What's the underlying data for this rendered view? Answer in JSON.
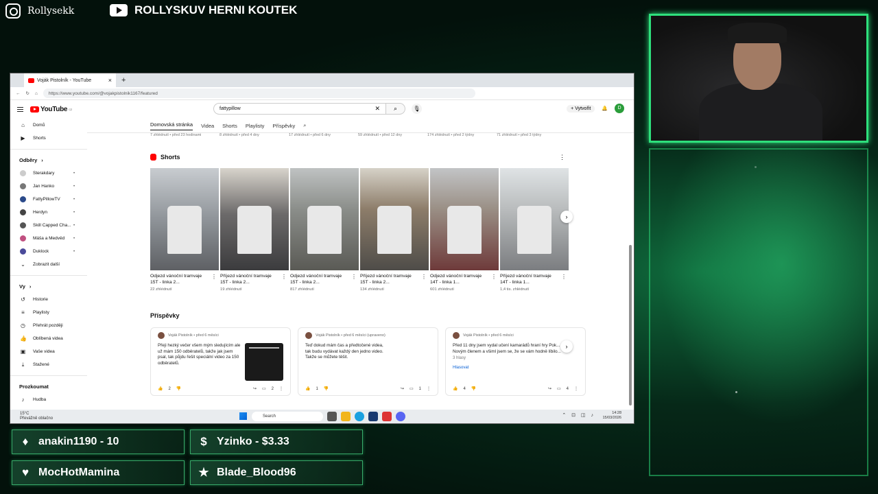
{
  "overlay": {
    "instagram": "Rollysekk",
    "stream_title": "ROLLYSKUV HERNI KOUTEK",
    "alerts": [
      {
        "icon": "diamond-icon",
        "text": "anakin1190 - 10"
      },
      {
        "icon": "dollar-icon",
        "text": "Yzinko - $3.33"
      },
      {
        "icon": "heart-icon",
        "text": "MocHotMamina"
      },
      {
        "icon": "star-icon",
        "text": "Blade_Blood96"
      }
    ]
  },
  "browser": {
    "tab_title": "Voják Pistolník - YouTube",
    "url": "https://www.youtube.com/@vojakpistolnik1167/featured",
    "youtube": {
      "logo": "YouTube",
      "logo_region": "CZ",
      "search_value": "fattypillow",
      "create_label": "Vytvořit",
      "avatar_letter": "D",
      "sidebar": {
        "main": [
          {
            "icon": "home-icon",
            "label": "Domů"
          },
          {
            "icon": "shorts-icon",
            "label": "Shorts"
          }
        ],
        "subs_header": "Odběry",
        "subs": [
          "Sterakdary",
          "Jan Hanko",
          "FattyPillowTV",
          "Herdyn",
          "Skill Capped Cha...",
          "Máša a Medvěd",
          "Duklock"
        ],
        "show_more": "Zobrazit další",
        "you_header": "Vy",
        "you": [
          {
            "icon": "history-icon",
            "label": "Historie"
          },
          {
            "icon": "playlist-icon",
            "label": "Playlisty"
          },
          {
            "icon": "clock-icon",
            "label": "Přehrát později"
          },
          {
            "icon": "like-icon",
            "label": "Oblíbená videa"
          },
          {
            "icon": "video-icon",
            "label": "Vaše videa"
          },
          {
            "icon": "download-icon",
            "label": "Stažené"
          }
        ],
        "explore_header": "Prozkoumat",
        "explore": [
          {
            "icon": "music-icon",
            "label": "Hudba"
          }
        ]
      },
      "channel_tabs": [
        "Domovská stránka",
        "Videa",
        "Shorts",
        "Playlisty",
        "Příspěvky"
      ],
      "prev_row": [
        "7 zhlédnutí • před 23 hodinami",
        "8 zhlédnutí • před 4 dny",
        "17 zhlédnutí • před 6 dny",
        "59 zhlédnutí • před 12 dny",
        "174 zhlédnutí • před 2 týdny",
        "71 zhlédnutí • před 3 týdny"
      ],
      "shorts_header": "Shorts",
      "shorts": [
        {
          "title": "Odjezd vánoční tramvaje 15T - linka 2...",
          "views": "22 zhlédnutí"
        },
        {
          "title": "Příjezd vánoční tramvaje 15T - linka 2...",
          "views": "19 zhlédnutí"
        },
        {
          "title": "Odjezd vánoční tramvaje 15T - linka 2...",
          "views": "817 zhlédnutí"
        },
        {
          "title": "Příjezd vánoční tramvaje 15T - linka 2...",
          "views": "134 zhlédnutí"
        },
        {
          "title": "Odjezd vánoční tramvaje 14T - linka 1...",
          "views": "601 zhlédnutí"
        },
        {
          "title": "Příjezd vánoční tramvaje 14T - linka 1...",
          "views": "1,4 tis. zhlédnutí"
        }
      ],
      "posts_header": "Příspěvky",
      "posts": [
        {
          "author": "Voják Pistolník • před 6 měsíci",
          "text": "Přeji hezký večer všem mým sledujícím ale už mám 150 odběratelů, takže jak jsem psal, tak půjdu řešit speciální video za 150 odběratelů.",
          "likes": "2",
          "comments": "2"
        },
        {
          "author": "Voják Pistolník • před 6 měsíci (upraveno)",
          "text": "Teď dokud mám čas a předtočené videa, tak budu vydávat každý den jedno video. Takže se můžete těšit.",
          "likes": "1",
          "comments": "1"
        },
        {
          "author": "Voják Pistolník • před 6 měsíci",
          "text": "Před 11 dny jsem vydal učení kamarádů hraní hry Pok... s Novým členem a všiml jsem se, že se vám hodně líbilo...",
          "votes": "3 hlasy",
          "vote_label": "Hlasovat",
          "likes": "4",
          "comments": "4"
        }
      ]
    }
  },
  "taskbar": {
    "weather_temp": "15°C",
    "weather_desc": "Převážně oblačno",
    "search": "Search",
    "time": "14:28",
    "date": "15/03/2026"
  }
}
